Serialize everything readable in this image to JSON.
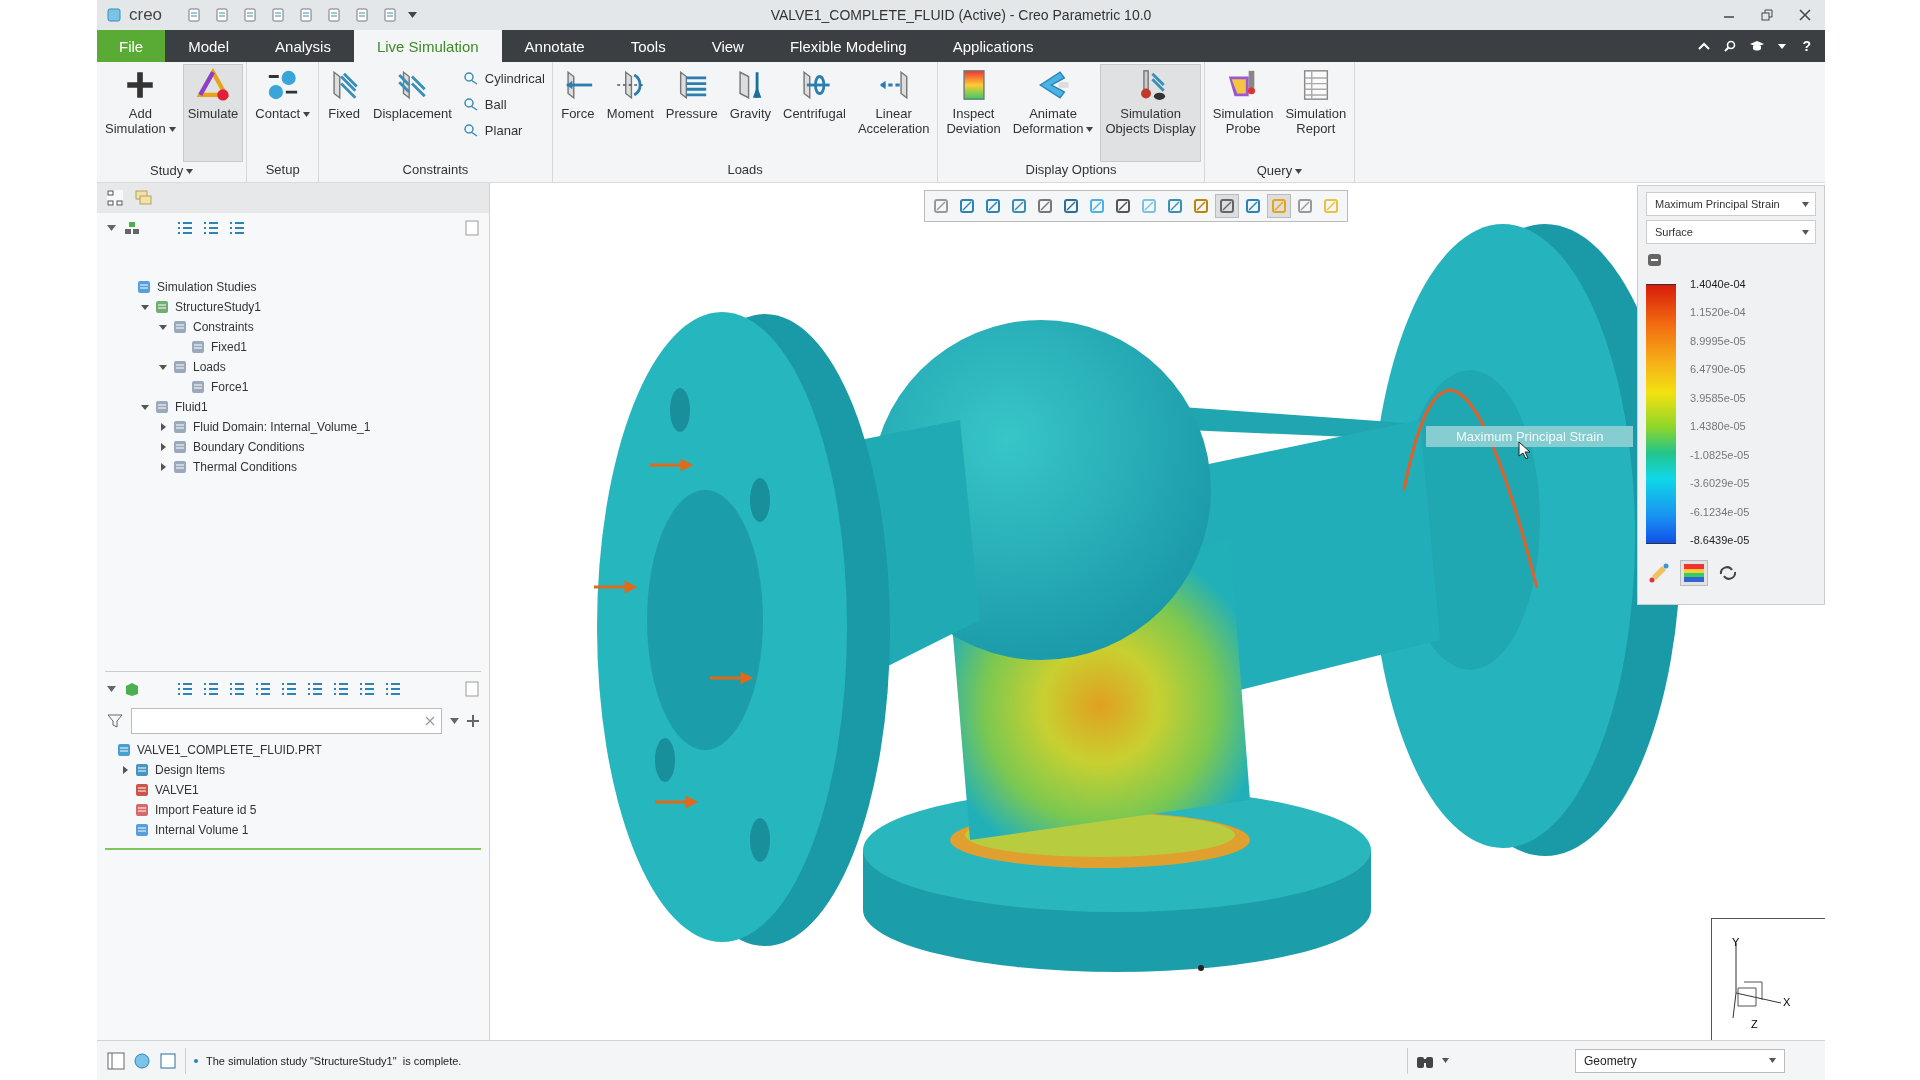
{
  "window": {
    "logo": "creo",
    "help": "?",
    "title": "VALVE1_COMPLETE_FLUID (Active) - Creo Parametric 10.0"
  },
  "menu_tabs": [
    {
      "label": "File",
      "kind": "file",
      "selected": false
    },
    {
      "label": "Model",
      "kind": "tab",
      "selected": false
    },
    {
      "label": "Analysis",
      "kind": "tab",
      "selected": false
    },
    {
      "label": "Live Simulation",
      "kind": "tab",
      "selected": true
    },
    {
      "label": "Annotate",
      "kind": "tab",
      "selected": false
    },
    {
      "label": "Tools",
      "kind": "tab",
      "selected": false
    },
    {
      "label": "View",
      "kind": "tab",
      "selected": false
    },
    {
      "label": "Flexible Modeling",
      "kind": "tab",
      "selected": false
    },
    {
      "label": "Applications",
      "kind": "tab",
      "selected": false
    }
  ],
  "ribbon_groups": [
    {
      "label": "Study",
      "dropdown": true,
      "buttons": [
        {
          "label": "Add\nSimulation",
          "dropdown": true,
          "selected": false
        },
        {
          "label": "Simulate",
          "dropdown": false,
          "selected": true
        }
      ]
    },
    {
      "label": "Setup",
      "dropdown": false,
      "buttons": [
        {
          "label": "Contact",
          "dropdown": true,
          "selected": false
        }
      ]
    },
    {
      "label": "Constraints",
      "dropdown": false,
      "buttons": [
        {
          "label": "Fixed",
          "dropdown": false,
          "selected": false
        },
        {
          "label": "Displacement",
          "dropdown": false,
          "selected": false
        }
      ],
      "small_buttons": [
        "Cylindrical",
        "Ball",
        "Planar"
      ]
    },
    {
      "label": "Loads",
      "dropdown": false,
      "buttons": [
        {
          "label": "Force",
          "dropdown": false,
          "selected": false
        },
        {
          "label": "Moment",
          "dropdown": false,
          "selected": false
        },
        {
          "label": "Pressure",
          "dropdown": false,
          "selected": false
        },
        {
          "label": "Gravity",
          "dropdown": false,
          "selected": false
        },
        {
          "label": "Centrifugal",
          "dropdown": false,
          "selected": false
        },
        {
          "label": "Linear\nAcceleration",
          "dropdown": false,
          "selected": false
        }
      ]
    },
    {
      "label": "Display Options",
      "dropdown": false,
      "buttons": [
        {
          "label": "Inspect\nDeviation",
          "dropdown": false,
          "selected": false
        },
        {
          "label": "Animate\nDeformation",
          "dropdown": true,
          "selected": false
        },
        {
          "label": "Simulation\nObjects Display",
          "dropdown": false,
          "selected": true
        }
      ]
    },
    {
      "label": "Query",
      "dropdown": true,
      "buttons": [
        {
          "label": "Simulation\nProbe",
          "dropdown": false,
          "selected": false
        },
        {
          "label": "Simulation\nReport",
          "dropdown": false,
          "selected": false
        }
      ]
    }
  ],
  "model_tree": [
    {
      "label": "Simulation Studies",
      "children": [
        {
          "label": "StructureStudy1",
          "expanded": true,
          "children": [
            {
              "label": "Constraints",
              "expanded": true,
              "children": [
                {
                  "label": "Fixed1"
                }
              ]
            },
            {
              "label": "Loads",
              "expanded": true,
              "children": [
                {
                  "label": "Force1"
                }
              ]
            }
          ]
        },
        {
          "label": "Fluid1",
          "expanded": true,
          "children": [
            {
              "label": "Fluid Domain: Internal_Volume_1",
              "expanded": false
            },
            {
              "label": "Boundary Conditions",
              "expanded": false
            },
            {
              "label": "Thermal Conditions",
              "expanded": false
            }
          ]
        }
      ]
    }
  ],
  "part_tree": [
    {
      "label": "VALVE1_COMPLETE_FLUID.PRT",
      "children": [
        {
          "label": "Design Items",
          "expanded": false
        },
        {
          "label": "VALVE1"
        },
        {
          "label": "Import Feature id 5"
        },
        {
          "label": "Internal Volume 1"
        }
      ]
    }
  ],
  "view_toolbar": [
    {
      "selected": false
    },
    {
      "selected": false
    },
    {
      "selected": false
    },
    {
      "selected": false
    },
    {
      "selected": false
    },
    {
      "selected": false
    },
    {
      "selected": false
    },
    {
      "selected": false
    },
    {
      "selected": false
    },
    {
      "selected": false
    },
    {
      "selected": false
    },
    {
      "selected": true
    },
    {
      "selected": false
    },
    {
      "selected": true
    },
    {
      "selected": false
    },
    {
      "selected": false
    }
  ],
  "viewport": {
    "tooltip": "Maximum Principal Strain",
    "triad": {
      "y": "Y",
      "x": "X",
      "z": "Z"
    }
  },
  "legend": {
    "quantity": "Maximum Principal Strain",
    "display": "Surface",
    "values": [
      "1.4040e-04",
      "1.1520e-04",
      "8.9995e-05",
      "6.4790e-05",
      "3.9585e-05",
      "1.4380e-05",
      "-1.0825e-05",
      "-3.6029e-05",
      "-6.1234e-05",
      "-8.6439e-05"
    ]
  },
  "status_bar": {
    "message": "The simulation study \"StructureStudy1\"  is complete.",
    "display_filter": "Geometry"
  }
}
